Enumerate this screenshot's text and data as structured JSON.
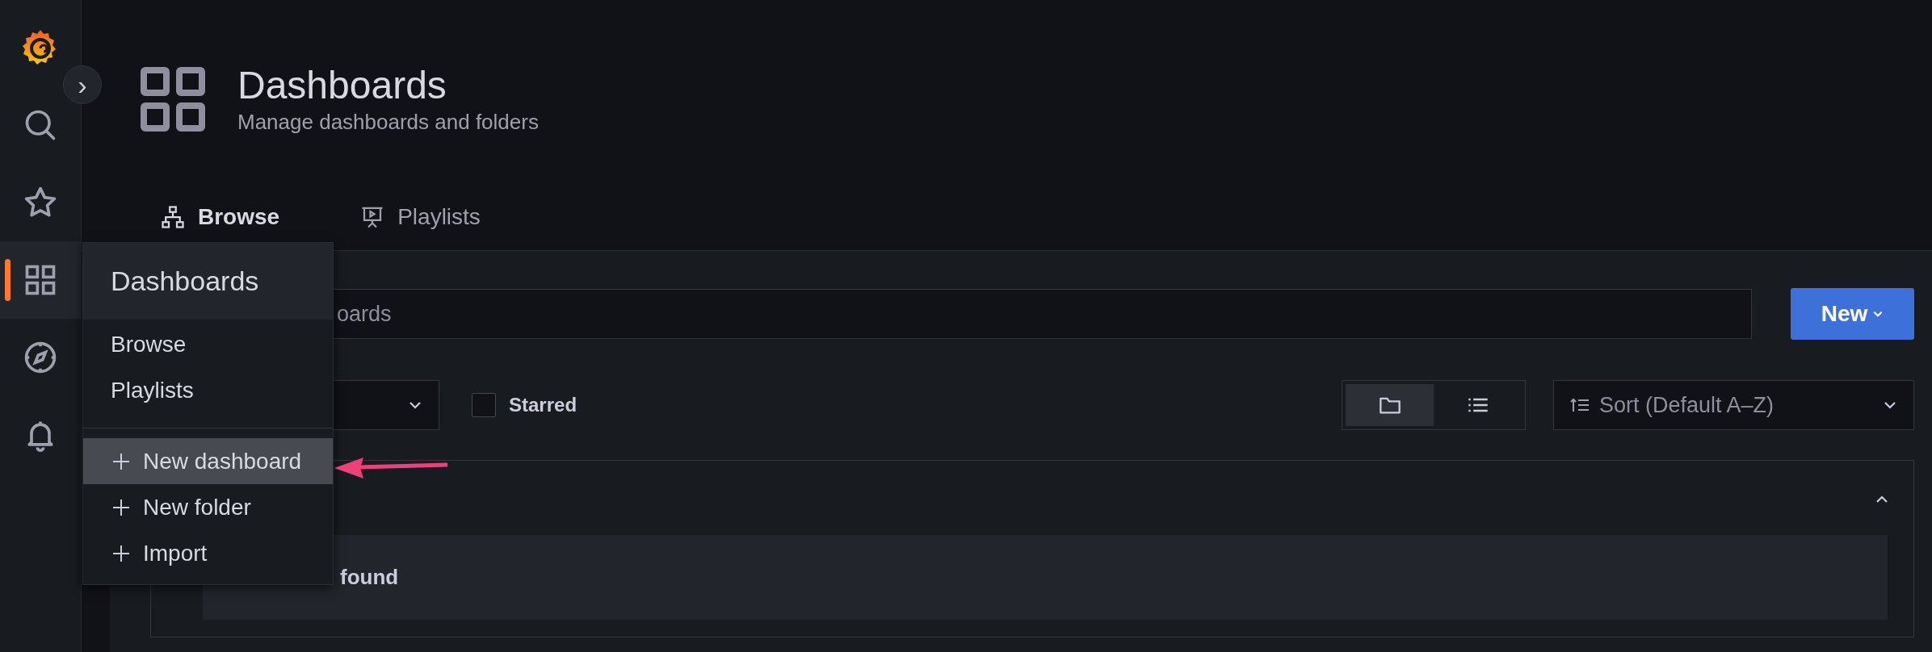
{
  "sidebar": {
    "items": [
      {
        "kind": "logo",
        "selected": false
      },
      {
        "kind": "search",
        "selected": false
      },
      {
        "kind": "star",
        "selected": false
      },
      {
        "kind": "dashboards",
        "selected": true
      },
      {
        "kind": "compass",
        "selected": false
      },
      {
        "kind": "bell",
        "selected": false
      }
    ]
  },
  "expand_button": {
    "label": "›"
  },
  "header": {
    "title": "Dashboards",
    "subtitle": "Manage dashboards and folders"
  },
  "tabs": [
    {
      "kind": "browse",
      "label": "Browse",
      "selected": true
    },
    {
      "kind": "playlists",
      "label": "Playlists",
      "selected": false
    }
  ],
  "search": {
    "placeholder": "oards"
  },
  "new_button": {
    "label": "New"
  },
  "filters": {
    "starred": {
      "label": "Starred",
      "checked": false
    },
    "sort": {
      "label": "Sort (Default A–Z)"
    },
    "view_toggle": [
      {
        "kind": "folders",
        "selected": true
      },
      {
        "kind": "list",
        "selected": false
      }
    ]
  },
  "folder_panel": {
    "expanded": true,
    "empty_text": "found"
  },
  "menu": {
    "title": "Dashboards",
    "items": [
      {
        "kind": "link",
        "label": "Browse",
        "selected": false
      },
      {
        "kind": "link",
        "label": "Playlists",
        "selected": false
      },
      {
        "kind": "divider"
      },
      {
        "kind": "add",
        "label": "New dashboard",
        "selected": true
      },
      {
        "kind": "add",
        "label": "New folder",
        "selected": false
      },
      {
        "kind": "add",
        "label": "Import",
        "selected": false
      }
    ]
  },
  "annotation": {
    "kind": "arrow"
  }
}
